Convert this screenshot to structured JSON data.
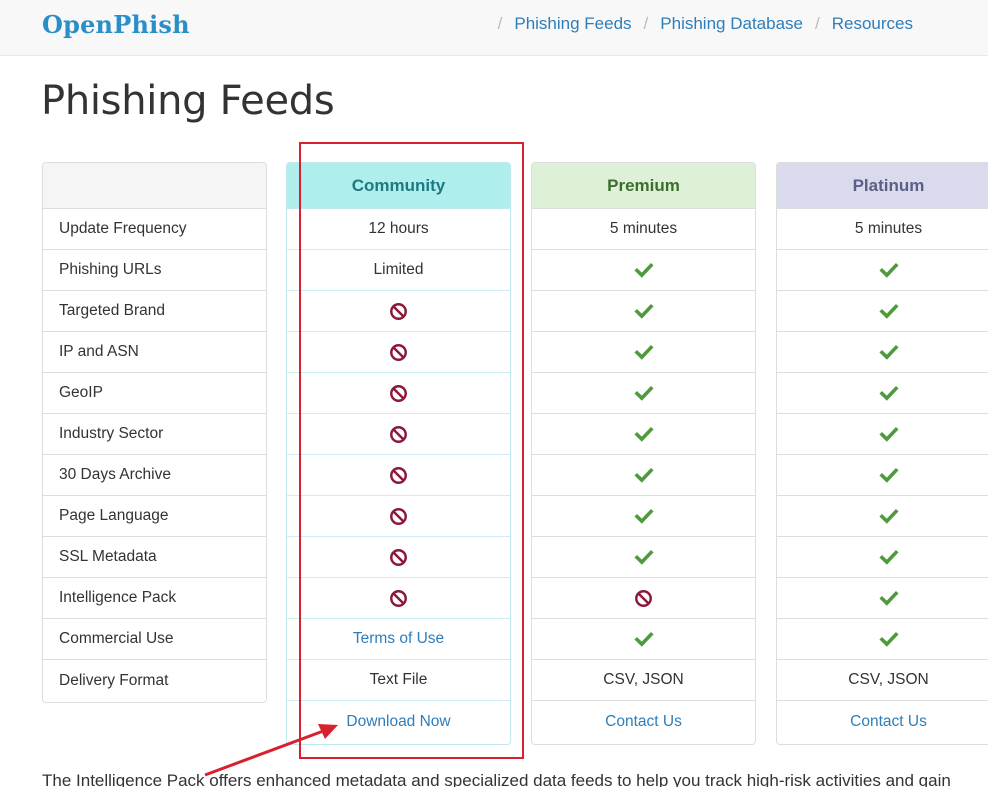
{
  "navbar": {
    "brand": "OpenPhish",
    "links": [
      "Phishing Feeds",
      "Phishing Database",
      "Resources"
    ],
    "separator": "/"
  },
  "page_title": "Phishing Feeds",
  "features": [
    "Update Frequency",
    "Phishing URLs",
    "Targeted Brand",
    "IP and ASN",
    "GeoIP",
    "Industry Sector",
    "30 Days Archive",
    "Page Language",
    "SSL Metadata",
    "Intelligence Pack",
    "Commercial Use",
    "Delivery Format"
  ],
  "plans": {
    "community": {
      "name": "Community",
      "update_frequency": "12 hours",
      "phishing_urls": "Limited",
      "commercial_use": "Terms of Use",
      "delivery_format": "Text File",
      "cta": "Download Now"
    },
    "premium": {
      "name": "Premium",
      "update_frequency": "5 minutes",
      "delivery_format": "CSV, JSON",
      "cta": "Contact Us"
    },
    "platinum": {
      "name": "Platinum",
      "update_frequency": "5 minutes",
      "delivery_format": "CSV, JSON",
      "cta": "Contact Us"
    }
  },
  "colors": {
    "check": "#4f9a3c",
    "not_included": "#8b1a3a",
    "link": "#2f7db9",
    "highlight": "#d9202e"
  },
  "icons": {
    "included": "check-icon",
    "not_included": "prohibited-icon"
  },
  "bottom_text": "The Intelligence Pack offers enhanced metadata and specialized data feeds to help you track high-risk activities and gain"
}
